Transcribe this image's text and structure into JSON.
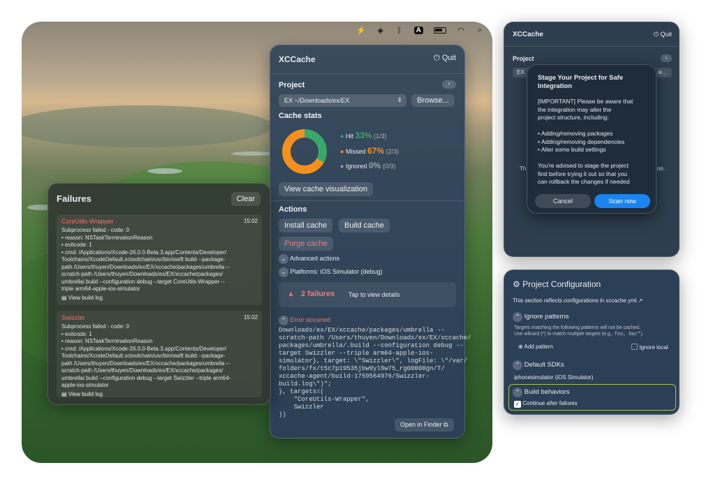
{
  "menubar": {
    "icons": [
      "bolt-icon",
      "box-icon",
      "bluetooth-icon",
      "input-source-icon",
      "battery-icon",
      "wifi-icon",
      "search-icon"
    ],
    "input_label": "A"
  },
  "main": {
    "title": "XCCache",
    "quit": "Quit",
    "project_label": "Project",
    "project_value": "EX  ~/Downloads/ex/EX",
    "browse": "Browse...",
    "cache_stats": "Cache stats",
    "hit_label": "Hit",
    "hit_pct": "33%",
    "hit_count": "(1/3)",
    "missed_label": "Missed",
    "missed_pct": "67%",
    "missed_count": "(2/3)",
    "ignored_label": "Ignored",
    "ignored_pct": "0%",
    "ignored_count": "(0/3)",
    "donut": {
      "hit": 0.33,
      "missed": 0.67,
      "ignored": 0,
      "hit_color": "#3aa86a",
      "missed_color": "#f5901e"
    },
    "view_viz": "View cache visualization",
    "actions": "Actions",
    "install": "Install cache",
    "build": "Build cache",
    "purge": "Purge cache",
    "advanced": "Advanced actions",
    "platforms": "Platforms:",
    "platforms_value": "iOS Simulator (debug)",
    "failures_count": "2 failures",
    "failures_tap": "Tap to view details",
    "error": "Error occurred",
    "log": "Downloads/ex/EX/xccache/packages/umbrella --\nscratch-path /Users/thuyen/Downloads/ex/EX/xccache/\npackages/umbrella/.build --configuration debug --\ntarget Swizzler --triple arm64-apple-ios-\nsimulator}, target: \\\"Swizzler\\\", logFile: \\\"/var/\nfolders/fx/t5c7p19535jbw9yl9w75_rg00000gn/T/\nxccache-agent/build-1759564976/Swizzler-\nbuild.log\\\")\";\n}, targets=(\n    \"CoreUtils-Wrapper\",\n    Swizzler\n))",
    "open_finder": "Open in Finder"
  },
  "failures": {
    "title": "Failures",
    "clear": "Clear",
    "items": [
      {
        "name": "CoreUtils-Wrapper",
        "time": "15:02",
        "text": "Subprocess failed - code: 0\n• reason: NSTaskTerminationReason\n• exitcode: 1\n• cmd: /Applications/Xcode-26.0.0-Beta.3.app/Contents/Developer/\nToolchains/XcodeDefault.xctoolchain/usr/bin/swift build --package-\npath /Users/thuyen/Downloads/ex/EX/xccache/packages/umbrella --\nscratch-path /Users/thuyen/Downloads/ex/EX/xccache/packages/\numbrella/.build --configuration debug --target CoreUtils-Wrapper --\ntriple arm64-apple-ios-simulator",
        "log": "View build log"
      },
      {
        "name": "Swizzler",
        "time": "15:02",
        "text": "Subprocess failed - code: 0\n• exitcode: 1\n• reason: NSTaskTerminationReason\n• cmd: /Applications/Xcode-26.0.0-Beta.3.app/Contents/Developer/\nToolchains/XcodeDefault.xctoolchain/usr/bin/swift build --package-\npath /Users/thuyen/Downloads/ex/EX/xccache/packages/umbrella --\nscratch-path /Users/thuyen/Downloads/ex/EX/xccache/packages/\numbrella/.build --configuration debug --target Swizzler --triple arm64-\napple-ios-simulator",
        "log": "View build log"
      }
    ]
  },
  "stage": {
    "title": "XCCache",
    "quit": "Quit",
    "project": "Project",
    "ex": "EX",
    "e": "e...",
    "th": "Th",
    "on": "on.",
    "modal_title": "Stage Your Project for Safe Integration",
    "modal_body": "[IMPORTANT] Please be aware that\nthe integration may alter the\nproject structure, including:\n\n• Adding/removing packages\n• Adding/removing dependencies\n• Alter some build settings\n\nYou're advised to stage the project\nfirst before trying it out so that you\ncan rollback the changes if needed",
    "cancel": "Cancel",
    "scan": "Scan now"
  },
  "config": {
    "title": "Project Configuration",
    "desc_prefix": "This section reflects configurations in",
    "desc_file": "xccache.yml",
    "ignore": "Ignore patterns",
    "ignore_desc1": "Targets matching the following patterns will not be cached.",
    "ignore_desc2": "Use wilcard (*) to match multiple targets (e.g.,",
    "ignore_ex": "foo, bar*",
    "ignore_desc3": ").",
    "add": "Add pattern",
    "ignore_local": "Ignore local",
    "sdks": "Default SDKs",
    "sdk_value": "iphonesimulator (iOS Simulator)",
    "build": "Build behaviors",
    "continue": "Continue after failures"
  }
}
